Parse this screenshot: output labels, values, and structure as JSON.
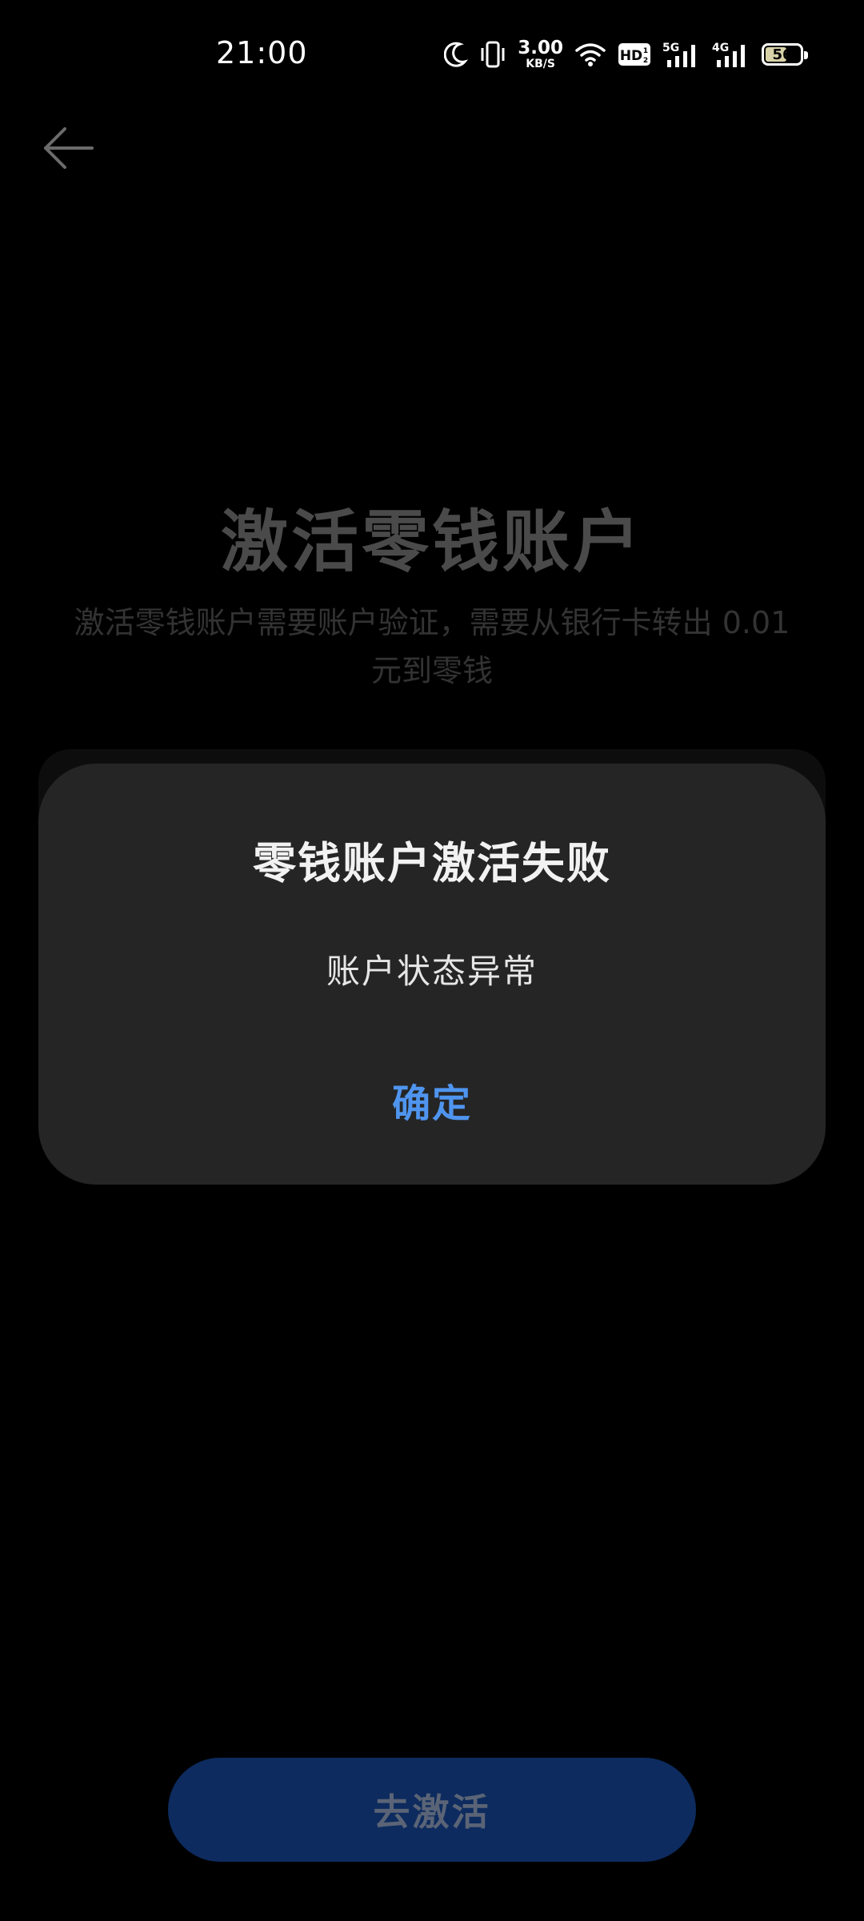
{
  "status_bar": {
    "time": "21:00",
    "net_speed_value": "3.00",
    "net_speed_unit": "KB/S",
    "hd_label": "HD",
    "sim1_label": "5G",
    "sim2_label": "4G",
    "battery_level": "56",
    "icons": [
      "moon-icon",
      "vibrate-icon",
      "wifi-icon",
      "hd-icon",
      "signal-5g-icon",
      "signal-4g-icon",
      "battery-icon"
    ]
  },
  "nav": {
    "back_icon": "arrow-left-icon"
  },
  "page": {
    "title": "激活零钱账户",
    "description": "激活零钱账户需要账户验证，需要从银行卡转出 0.01 元到零钱"
  },
  "dialog": {
    "title": "零钱账户激活失败",
    "message": "账户状态异常",
    "confirm_label": "确定"
  },
  "footer": {
    "activate_label": "去激活"
  },
  "colors": {
    "background": "#000000",
    "dialog_bg": "#252525",
    "accent": "#4f95ef",
    "button_dim": "#0d2b5e"
  }
}
